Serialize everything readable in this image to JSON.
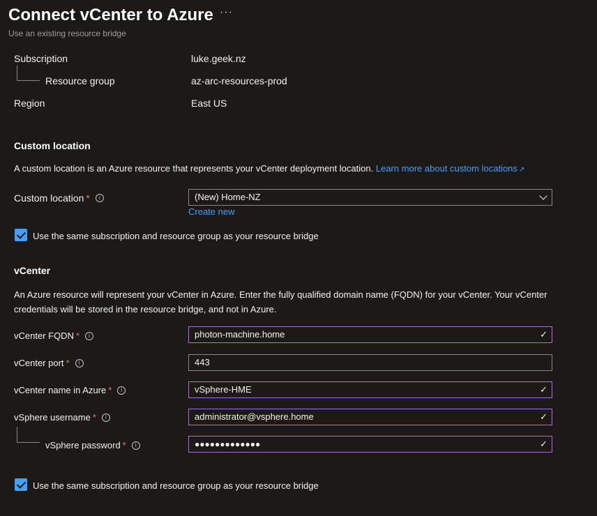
{
  "header": {
    "title": "Connect vCenter to Azure",
    "more_label": "···",
    "subtitle": "Use an existing resource bridge"
  },
  "summary": {
    "subscription_label": "Subscription",
    "subscription_value": "luke.geek.nz",
    "resource_group_label": "Resource group",
    "resource_group_value": "az-arc-resources-prod",
    "region_label": "Region",
    "region_value": "East US"
  },
  "custom_location": {
    "heading": "Custom location",
    "description": "A custom location is an Azure resource that represents your vCenter deployment location.",
    "learn_more": "Learn more about custom locations",
    "field_label": "Custom location",
    "required_mark": "*",
    "selected_value": "(New) Home-NZ",
    "create_new": "Create new",
    "checkbox_label": "Use the same subscription and resource group as your resource bridge",
    "checkbox_checked": true
  },
  "vcenter": {
    "heading": "vCenter",
    "description": "An Azure resource will represent your vCenter in Azure. Enter the fully qualified domain name (FQDN) for your vCenter. Your vCenter credentials will be stored in the resource bridge, and not in Azure.",
    "fqdn_label": "vCenter FQDN",
    "fqdn_value": "photon-machine.home",
    "port_label": "vCenter port",
    "port_value": "443",
    "name_label": "vCenter name in Azure",
    "name_value": "vSphere-HME",
    "username_label": "vSphere username",
    "username_value": "administrator@vsphere.home",
    "password_label": "vSphere password",
    "password_value": "●●●●●●●●●●●●●",
    "required_mark": "*",
    "info_glyph": "i",
    "check_glyph": "✓",
    "checkbox_label": "Use the same subscription and resource group as your resource bridge",
    "checkbox_checked": true
  },
  "colors": {
    "background": "#1b1a19",
    "accent": "#479ef5",
    "valid_border": "#b36bd6",
    "required": "#f1707b"
  }
}
